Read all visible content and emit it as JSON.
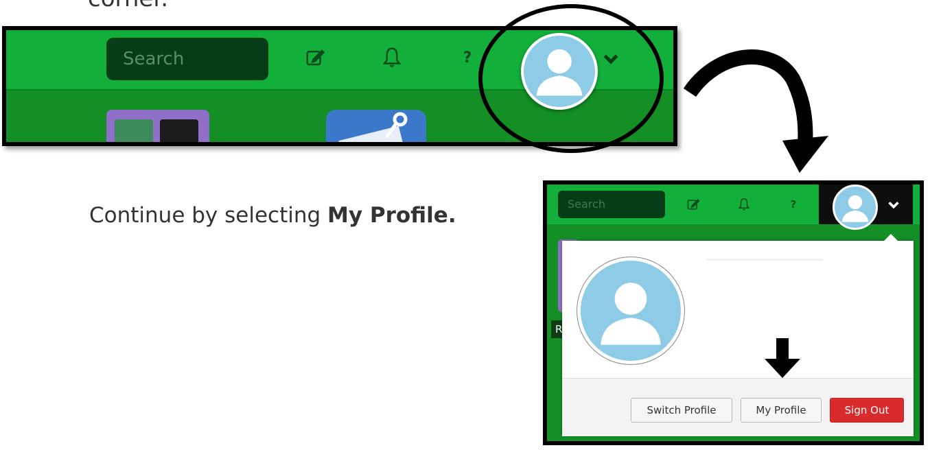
{
  "page": {
    "top_text": "corner.",
    "instruction_prefix": "Continue by selecting ",
    "instruction_bold": "My Profile",
    "instruction_suffix": "."
  },
  "header": {
    "search_placeholder": "Search",
    "help_label": "?"
  },
  "popup_header": {
    "search_placeholder": "Search",
    "help_label": "?",
    "background_label": "R"
  },
  "profile_popup": {
    "buttons": {
      "switch_profile": "Switch Profile",
      "my_profile": "My Profile",
      "sign_out": "Sign Out"
    }
  },
  "icons": {
    "compose": "compose-icon",
    "notifications": "bell-icon",
    "help": "help-icon",
    "avatar": "user-avatar-icon",
    "dropdown": "chevron-down-icon",
    "curved_arrow": "curved-arrow-icon",
    "down_arrow": "down-arrow-icon"
  },
  "colors": {
    "header_green": "#12b03a",
    "dark_green": "#063d16",
    "avatar_blue": "#8ecbe6",
    "sign_out_red": "#d92b2b"
  }
}
